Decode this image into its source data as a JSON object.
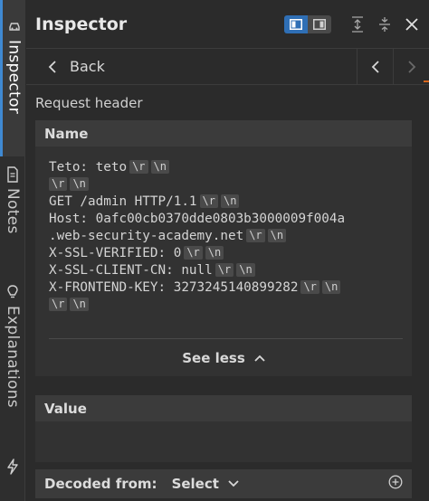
{
  "rail": {
    "tabs": [
      {
        "label": "Inspector",
        "icon": "car-icon",
        "active": true
      },
      {
        "label": "Notes",
        "icon": "document-icon",
        "active": false
      },
      {
        "label": "Explanations",
        "icon": "lightbulb-icon",
        "active": false
      },
      {
        "label": "",
        "icon": "lightning-icon",
        "active": false
      }
    ]
  },
  "header": {
    "title": "Inspector"
  },
  "nav": {
    "back_label": "Back"
  },
  "section": {
    "label": "Request header"
  },
  "name_card": {
    "heading": "Name",
    "lines": [
      {
        "text": "Teto: teto",
        "escapes": [
          "\\r",
          "\\n"
        ]
      },
      {
        "text": "",
        "escapes": [
          "\\r",
          "\\n"
        ]
      },
      {
        "text": "GET /admin HTTP/1.1",
        "escapes": [
          "\\r",
          "\\n"
        ]
      },
      {
        "text": "Host: 0afc00cb0370dde0803b3000009f004a",
        "escapes": []
      },
      {
        "text": ".web-security-academy.net",
        "escapes": [
          "\\r",
          "\\n"
        ]
      },
      {
        "text": "X-SSL-VERIFIED: 0",
        "escapes": [
          "\\r",
          "\\n"
        ]
      },
      {
        "text": "X-SSL-CLIENT-CN: null",
        "escapes": [
          "\\r",
          "\\n"
        ]
      },
      {
        "text": "X-FRONTEND-KEY: 3273245140899282",
        "escapes": [
          "\\r",
          "\\n"
        ]
      },
      {
        "text": "",
        "escapes": [
          "\\r",
          "\\n"
        ]
      }
    ],
    "see_less_label": "See less"
  },
  "value_card": {
    "heading": "Value"
  },
  "decoded": {
    "label": "Decoded from:",
    "select_value": "Select"
  },
  "colors": {
    "accent": "#2f6fb5",
    "background": "#2b2b2b",
    "orange": "#d8661d"
  }
}
